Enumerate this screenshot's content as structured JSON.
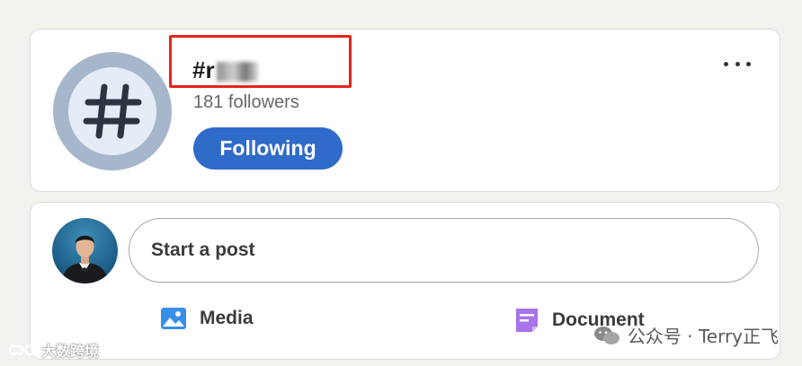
{
  "hashtag_card": {
    "title": "#r",
    "followers": "181 followers",
    "follow_button_label": "Following",
    "more_icon": "more-horizontal-icon",
    "avatar_icon": "hashtag-icon"
  },
  "post_composer": {
    "placeholder": "Start a post",
    "actions": [
      {
        "label": "Media",
        "icon": "image-icon",
        "color": "#378fe9"
      },
      {
        "label": "Document",
        "icon": "document-icon",
        "color": "#a872e8"
      }
    ]
  },
  "watermarks": {
    "left": "大数跨境",
    "right": "公众号 · Terry正飞"
  },
  "colors": {
    "accent": "#2f6bc8",
    "highlight_box": "#e8231e"
  }
}
